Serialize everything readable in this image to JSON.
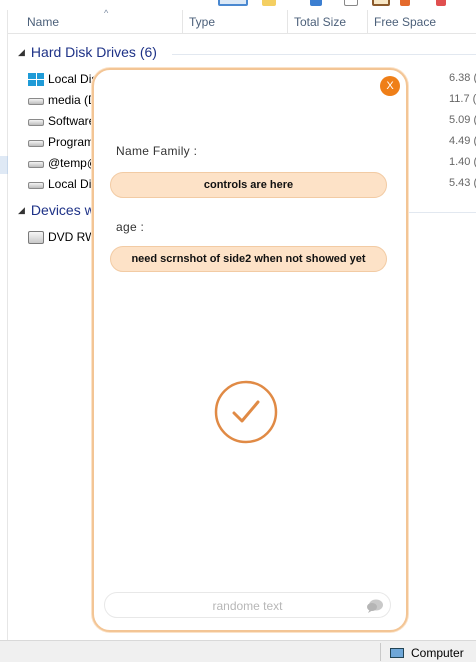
{
  "explorer": {
    "columns": [
      "Name",
      "Type",
      "Total Size",
      "Free Space"
    ],
    "groups": [
      {
        "label": "Hard Disk Drives (6)"
      },
      {
        "label": "Devices w"
      }
    ],
    "drives": [
      {
        "name": "Local Disk",
        "free": "6.38 (",
        "icon": "windows-drive-icon"
      },
      {
        "name": "media (D",
        "free": "11.7 (",
        "icon": "drive-icon"
      },
      {
        "name": "Software",
        "free": "5.09 (",
        "icon": "drive-icon"
      },
      {
        "name": "Program",
        "free": "4.49 (",
        "icon": "drive-icon"
      },
      {
        "name": "@temp@",
        "free": "1.40 (",
        "icon": "drive-icon"
      },
      {
        "name": "Local Disk",
        "free": "5.43 (",
        "icon": "drive-icon"
      }
    ],
    "devices": [
      {
        "name": "DVD RW",
        "icon": "dvd-drive-icon"
      }
    ],
    "status": {
      "computer_label": "Computer"
    }
  },
  "popup": {
    "close_label": "X",
    "fields": [
      {
        "label": "Name Family :",
        "value": "controls are here"
      },
      {
        "label": "age :",
        "value": "need scrnshot of side2 when not showed yet"
      }
    ],
    "success_icon": "check-circle-icon",
    "message_input": {
      "placeholder": "randome text",
      "icon": "chat-bubble-icon"
    },
    "colors": {
      "accent": "#ef7f18",
      "border": "#f3c595",
      "pill_bg": "#fde2c7",
      "check": "#e08a45"
    }
  }
}
